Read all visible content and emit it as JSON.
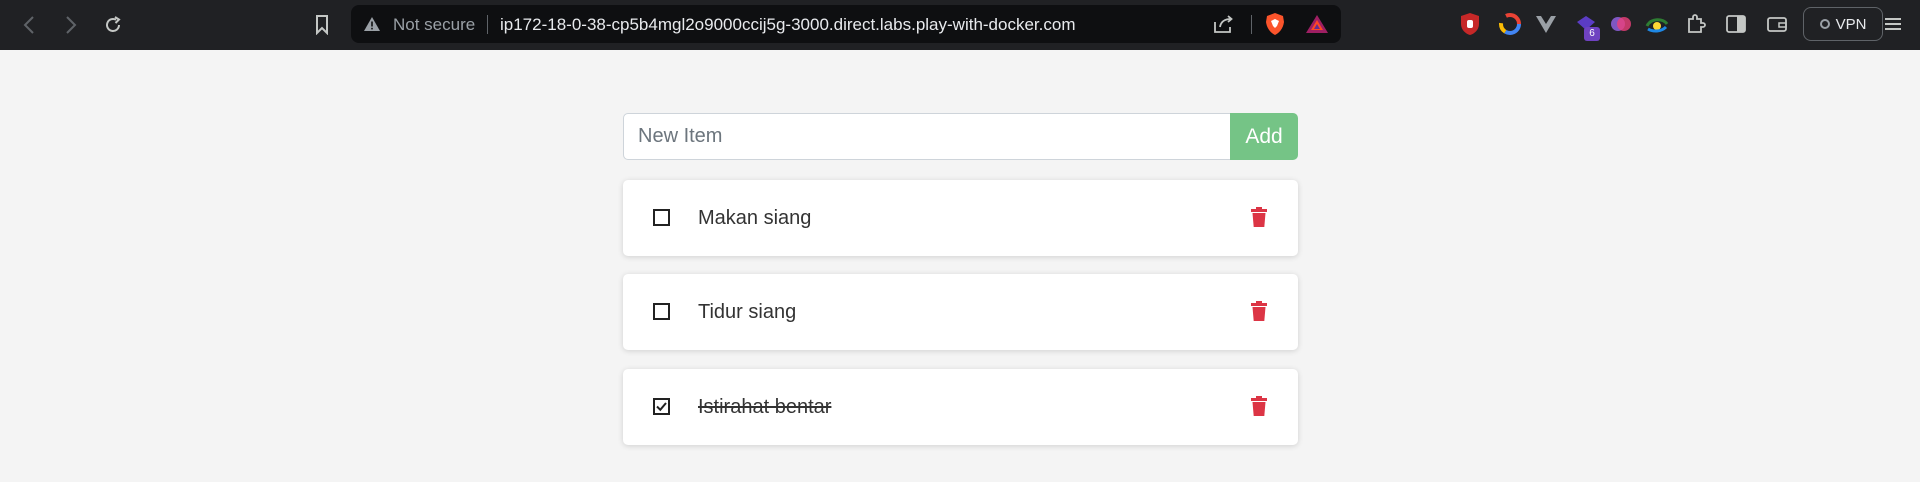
{
  "browser": {
    "security_label": "Not secure",
    "url": "ip172-18-0-38-cp5b4mgl2o9000ccij5g-3000.direct.labs.play-with-docker.com",
    "vpn_label": "VPN",
    "extension_badge": "6",
    "icons": [
      "back-icon",
      "forward-icon",
      "reload-icon",
      "bookmark-icon",
      "warning-icon",
      "share-icon",
      "brave-shield-icon",
      "bat-rewards-icon",
      "ublock-icon",
      "chrome-circle-icon",
      "vue-devtools-icon",
      "ext-purple-icon",
      "ext-brain-icon",
      "ext-eye-icon",
      "extensions-puzzle-icon",
      "sidebar-icon",
      "wallet-icon",
      "menu-icon"
    ]
  },
  "app": {
    "input_placeholder": "New Item",
    "input_value": "",
    "add_label": "Add",
    "accent_color": "#75c486",
    "delete_color": "#dc3545",
    "items": [
      {
        "name": "Makan siang",
        "completed": false
      },
      {
        "name": "Tidur siang",
        "completed": false
      },
      {
        "name": "Istirahat bentar",
        "completed": true
      }
    ]
  }
}
